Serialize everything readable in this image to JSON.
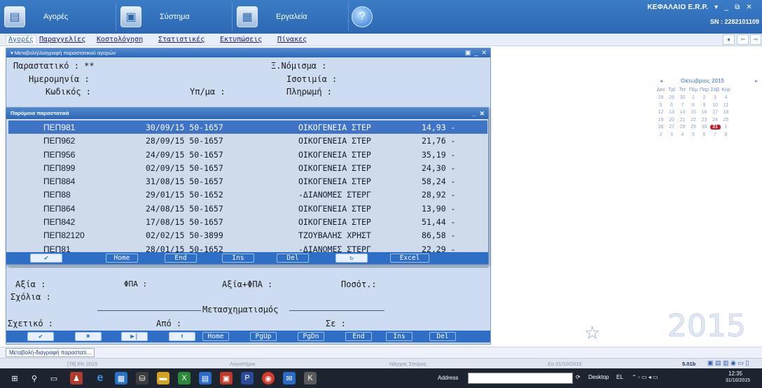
{
  "topbar": {
    "items": [
      {
        "label": "Αγορές",
        "icon": "purchases-icon"
      },
      {
        "label": "Σύστημα",
        "icon": "system-icon"
      },
      {
        "label": "Εργαλεία",
        "icon": "tools-icon"
      },
      {
        "label": "",
        "icon": "help-icon"
      }
    ],
    "company": "ΚΕΦΑΛΑΙΟ E.R.P.",
    "serial": "SN : 2282101109"
  },
  "menubar": {
    "items": [
      "Αγορές",
      "Παραγγελίες",
      "Κοστολόγηση",
      "Στατιστικές",
      "Εκτυπώσεις",
      "Πίνακες"
    ]
  },
  "form": {
    "title": "Μεταβολή/Διαγραφή παραστατικού αγορών",
    "label_document": "Παραστατικό : **",
    "label_date": "Ημερομηνία :",
    "label_code": "Κωδικός :",
    "label_branch": "Υπ/μα :",
    "label_currency": "Ξ.Νόμισμα :",
    "label_parity": "Ισοτιμία :",
    "label_payment": "Πληρωμή :",
    "label_value": "Αξία :",
    "label_vat": "ΦΠΑ :",
    "label_value_vat": "Αξία+ΦΠΑ :",
    "label_quantity": "Ποσότ.:",
    "label_comments": "Σχόλια :",
    "label_transform": "Μετασχηματισμός",
    "label_related": "Σχετικό :",
    "label_from": "Από :",
    "label_to": "Σε :",
    "bottom_keys": [
      "✔",
      "✖",
      "▶|",
      "⬆",
      "Home",
      "PgUp",
      "PgDn",
      "End",
      "Ins",
      "Del"
    ]
  },
  "popup": {
    "title": "Παρόμοια παραστατικά",
    "rows": [
      {
        "code": "ΠΕΠ981",
        "date": "30/09/15 50-1657",
        "name": "ΟΙΚΟΓΕΝΕΙΑ ΣΤΕΡ",
        "amount": "14,93 -"
      },
      {
        "code": "ΠΕΠ962",
        "date": "28/09/15 50-1657",
        "name": "ΟΙΚΟΓΕΝΕΙΑ ΣΤΕΡ",
        "amount": "21,76 -"
      },
      {
        "code": "ΠΕΠ956",
        "date": "24/09/15 50-1657",
        "name": "ΟΙΚΟΓΕΝΕΙΑ ΣΤΕΡ",
        "amount": "35,19 -"
      },
      {
        "code": "ΠΕΠ899",
        "date": "02/09/15 50-1657",
        "name": "ΟΙΚΟΓΕΝΕΙΑ ΣΤΕΡ",
        "amount": "24,30 -"
      },
      {
        "code": "ΠΕΠ884",
        "date": "31/08/15 50-1657",
        "name": "ΟΙΚΟΓΕΝΕΙΑ ΣΤΕΡ",
        "amount": "58,24 -"
      },
      {
        "code": "ΠΕΠ88",
        "date": "29/01/15 50-1652",
        "name": "-ΔΙΑΝΟΜΕΣ ΣΤΕΡΓ",
        "amount": "28,92 -"
      },
      {
        "code": "ΠΕΠ864",
        "date": "24/08/15 50-1657",
        "name": "ΟΙΚΟΓΕΝΕΙΑ ΣΤΕΡ",
        "amount": "13,90 -"
      },
      {
        "code": "ΠΕΠ842",
        "date": "17/08/15 50-1657",
        "name": "ΟΙΚΟΓΕΝΕΙΑ ΣΤΕΡ",
        "amount": "51,44 -"
      },
      {
        "code": "ΠΕΠ82120",
        "date": "02/02/15 50-3899",
        "name": "ΤΖΟΥΒΑΛΗΣ ΧΡΗΣΤ",
        "amount": "86,58 -"
      },
      {
        "code": "ΠΕΠ81",
        "date": "28/01/15 50-1652",
        "name": "-ΔΙΑΝΟΜΕΣ ΣΤΕΡΓ",
        "amount": "22,29 -"
      }
    ],
    "keys": [
      "✔",
      "Home",
      "End",
      "Ins",
      "Del",
      "↻",
      "Excel"
    ]
  },
  "calendar": {
    "month": "Οκτώβριος 2015",
    "weekdays": [
      "Δευ",
      "Τρί",
      "Τετ",
      "Πέμ",
      "Παρ",
      "Σάβ",
      "Κυρ"
    ],
    "weeks": [
      [
        "28",
        "29",
        "30",
        "1",
        "2",
        "3",
        "4"
      ],
      [
        "5",
        "6",
        "7",
        "8",
        "9",
        "10",
        "11"
      ],
      [
        "12",
        "13",
        "14",
        "15",
        "16",
        "17",
        "18"
      ],
      [
        "19",
        "20",
        "21",
        "22",
        "23",
        "24",
        "25"
      ],
      [
        "26",
        "27",
        "28",
        "29",
        "30",
        "31",
        "1"
      ],
      [
        "2",
        "3",
        "4",
        "5",
        "6",
        "7",
        "8"
      ]
    ],
    "today": "31"
  },
  "year_watermark": "2015",
  "tabstrip": {
    "open_tab": "Μεταβολή-διαγραφή παραστατι..."
  },
  "statusbar": {
    "fiscal": "[78] ΕΚ 2015",
    "dept": "Λογιστήριο",
    "user": "Νάρχος Σπύρος",
    "date": "Σα 31/10/2015",
    "version": "5.01b"
  },
  "taskbar": {
    "address_label": "Address",
    "desktop_label": "Desktop",
    "lang": "EL",
    "time": "12:35",
    "date": "31/10/2015"
  },
  "colors": {
    "accent": "#2f6ec7",
    "selected_row": "#3e73c6",
    "today": "#c01828"
  }
}
